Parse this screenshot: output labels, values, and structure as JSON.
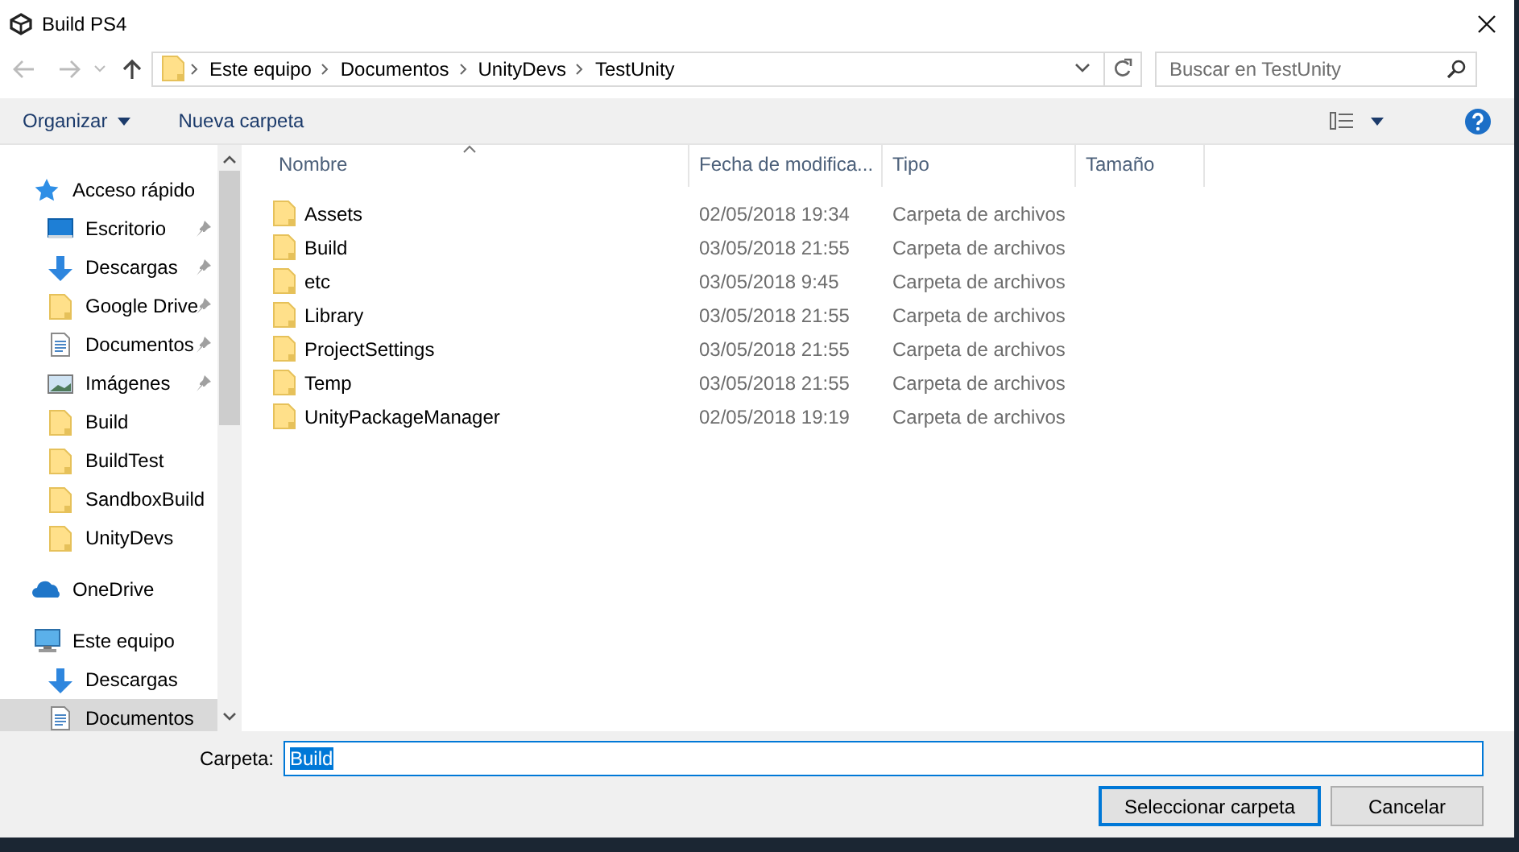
{
  "window": {
    "title": "Build PS4"
  },
  "address": {
    "path": [
      "Este equipo",
      "Documentos",
      "UnityDevs",
      "TestUnity"
    ]
  },
  "search": {
    "placeholder": "Buscar en TestUnity"
  },
  "toolbar": {
    "organize": "Organizar",
    "new_folder": "Nueva carpeta"
  },
  "sidebar": {
    "items": [
      {
        "label": "Acceso rápido",
        "kind": "star",
        "selected": false,
        "children": [
          {
            "label": "Escritorio",
            "kind": "desktop",
            "pinned": true,
            "selected": false
          },
          {
            "label": "Descargas",
            "kind": "download",
            "pinned": true,
            "selected": false
          },
          {
            "label": "Google Drive",
            "kind": "folder",
            "pinned": true,
            "selected": false
          },
          {
            "label": "Documentos",
            "kind": "document",
            "pinned": true,
            "selected": false
          },
          {
            "label": "Imágenes",
            "kind": "images",
            "pinned": true,
            "selected": false
          },
          {
            "label": "Build",
            "kind": "folder",
            "pinned": false,
            "selected": false
          },
          {
            "label": "BuildTest",
            "kind": "folder",
            "pinned": false,
            "selected": false
          },
          {
            "label": "SandboxBuild",
            "kind": "folder",
            "pinned": false,
            "selected": false
          },
          {
            "label": "UnityDevs",
            "kind": "folder",
            "pinned": false,
            "selected": false
          }
        ]
      },
      {
        "label": "OneDrive",
        "kind": "cloud",
        "selected": false
      },
      {
        "label": "Este equipo",
        "kind": "computer",
        "selected": false,
        "children": [
          {
            "label": "Descargas",
            "kind": "download",
            "pinned": false,
            "selected": false
          },
          {
            "label": "Documentos",
            "kind": "document",
            "pinned": false,
            "selected": true
          }
        ]
      }
    ]
  },
  "table": {
    "columns": [
      "Nombre",
      "Fecha de modifica...",
      "Tipo",
      "Tamaño"
    ],
    "rows": [
      {
        "name": "Assets",
        "date": "02/05/2018 19:34",
        "type": "Carpeta de archivos"
      },
      {
        "name": "Build",
        "date": "03/05/2018 21:55",
        "type": "Carpeta de archivos"
      },
      {
        "name": "etc",
        "date": "03/05/2018 9:45",
        "type": "Carpeta de archivos"
      },
      {
        "name": "Library",
        "date": "03/05/2018 21:55",
        "type": "Carpeta de archivos"
      },
      {
        "name": "ProjectSettings",
        "date": "03/05/2018 21:55",
        "type": "Carpeta de archivos"
      },
      {
        "name": "Temp",
        "date": "03/05/2018 21:55",
        "type": "Carpeta de archivos"
      },
      {
        "name": "UnityPackageManager",
        "date": "02/05/2018 19:19",
        "type": "Carpeta de archivos"
      }
    ]
  },
  "footer": {
    "label": "Carpeta:",
    "value": "Build",
    "buttons": [
      {
        "label": "Seleccionar carpeta",
        "kind": "primary"
      },
      {
        "label": "Cancelar",
        "kind": "normal"
      }
    ]
  }
}
